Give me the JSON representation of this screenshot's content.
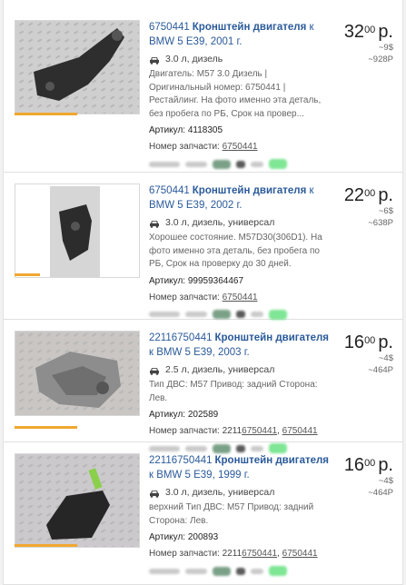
{
  "listings": [
    {
      "code": "6750441",
      "title_bold": "Кронштейн двигателя",
      "title_rest": " к BMW 5 E39, 2001 г.",
      "spec": "3.0 л, дизель",
      "description": "Двигатель: M57 3.0 Дизель | Оригинальный номер: 6750441 | Рестайлинг. На фото именно эта деталь, без пробега по РБ, Срок на провер...",
      "article_label": "Артикул: ",
      "article": "4118305",
      "part_label": "Номер запчасти: ",
      "part_prefix": "",
      "part_links": [
        "6750441"
      ],
      "price_int": "32",
      "price_dec": "00",
      "price_cur": "р.",
      "price_usd": "~9$",
      "price_rub": "~928Р",
      "photo_progress": 0.5
    },
    {
      "code": "6750441",
      "title_bold": "Кронштейн двигателя",
      "title_rest": " к BMW 5 E39, 2002 г.",
      "spec": "3.0 л, дизель, универсал",
      "description": "Хорошее состояние. M57D30(306D1). На фото именно эта деталь, без пробега по РБ, Срок на проверку до 30 дней.",
      "article_label": "Артикул: ",
      "article": "99959364467",
      "part_label": "Номер запчасти: ",
      "part_prefix": "",
      "part_links": [
        "6750441"
      ],
      "price_int": "22",
      "price_dec": "00",
      "price_cur": "р.",
      "price_usd": "~6$",
      "price_rub": "~638Р",
      "photo_progress": 0.2
    },
    {
      "code": "22116750441",
      "title_bold": "Кронштейн двигателя",
      "title_rest": " к BMW 5 E39, 2003 г.",
      "spec": "2.5 л, дизель, универсал",
      "description": "Тип ДВС: M57 Привод: задний Сторона: Лев.",
      "article_label": "Артикул: ",
      "article": "202589",
      "part_label": "Номер запчасти: ",
      "part_prefix": "2211",
      "part_links": [
        "6750441",
        "6750441"
      ],
      "price_int": "16",
      "price_dec": "00",
      "price_cur": "р.",
      "price_usd": "~4$",
      "price_rub": "~464Р",
      "photo_progress": 0.5
    },
    {
      "code": "22116750441",
      "title_bold": "Кронштейн двигателя",
      "title_rest": " к BMW 5 E39, 1999 г.",
      "spec": "3.0 л, дизель, универсал",
      "description": "верхний Тип ДВС: M57 Привод: задний Сторона: Лев.",
      "article_label": "Артикул: ",
      "article": "200893",
      "part_label": "Номер запчасти: ",
      "part_prefix": "2211",
      "part_links": [
        "6750441",
        "6750441"
      ],
      "price_int": "16",
      "price_dec": "00",
      "price_cur": "р.",
      "price_usd": "~4$",
      "price_rub": "~464Р",
      "photo_progress": 0.5
    }
  ],
  "colors": {
    "link": "#2a5a9a",
    "accent_bar": "#f0a830",
    "badge_green": "#5ee07a"
  },
  "icons": {
    "spec": "car-icon",
    "seller_badges": "blurred-seller-badges"
  }
}
